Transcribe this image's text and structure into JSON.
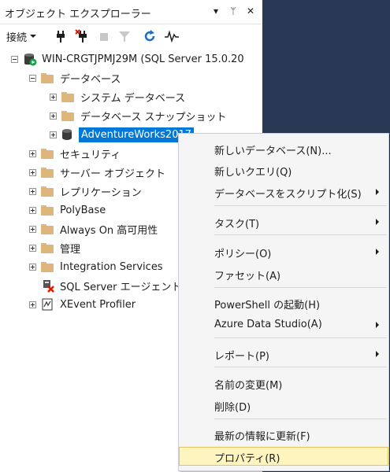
{
  "panel": {
    "title": "オブジェクト エクスプローラー",
    "title_buttons": {
      "dropdown": "▾",
      "pin": "ᛘ",
      "close": "✕"
    }
  },
  "toolbar": {
    "connect_label": "接続"
  },
  "tree": {
    "server": "WIN-CRGTJPMJ29M (SQL Server 15.0.20",
    "databases": "データベース",
    "system_databases": "システム データベース",
    "snapshots": "データベース スナップショット",
    "adventureworks": "AdventureWorks2017",
    "security": "セキュリティ",
    "server_objects": "サーバー オブジェクト",
    "replication": "レプリケーション",
    "polybase": "PolyBase",
    "always_on": "Always On 高可用性",
    "management": "管理",
    "integration_services": "Integration Services",
    "sql_agent": "SQL Server エージェント",
    "xevent_profiler": "XEvent Profiler"
  },
  "context_menu": {
    "new_database": "新しいデータベース(N)...",
    "new_query": "新しいクエリ(Q)",
    "script_database": "データベースをスクリプト化(S)",
    "tasks": "タスク(T)",
    "policies": "ポリシー(O)",
    "facets": "ファセット(A)",
    "start_powershell": "PowerShell の起動(H)",
    "azure_data_studio": "Azure Data Studio(A)",
    "reports": "レポート(P)",
    "rename": "名前の変更(M)",
    "delete": "削除(D)",
    "refresh": "最新の情報に更新(F)",
    "properties": "プロパティ(R)"
  },
  "colors": {
    "selection": "#0078d7",
    "menu_highlight": "#fdf4bf",
    "folder": "#dcb67a",
    "background": "#293955"
  }
}
